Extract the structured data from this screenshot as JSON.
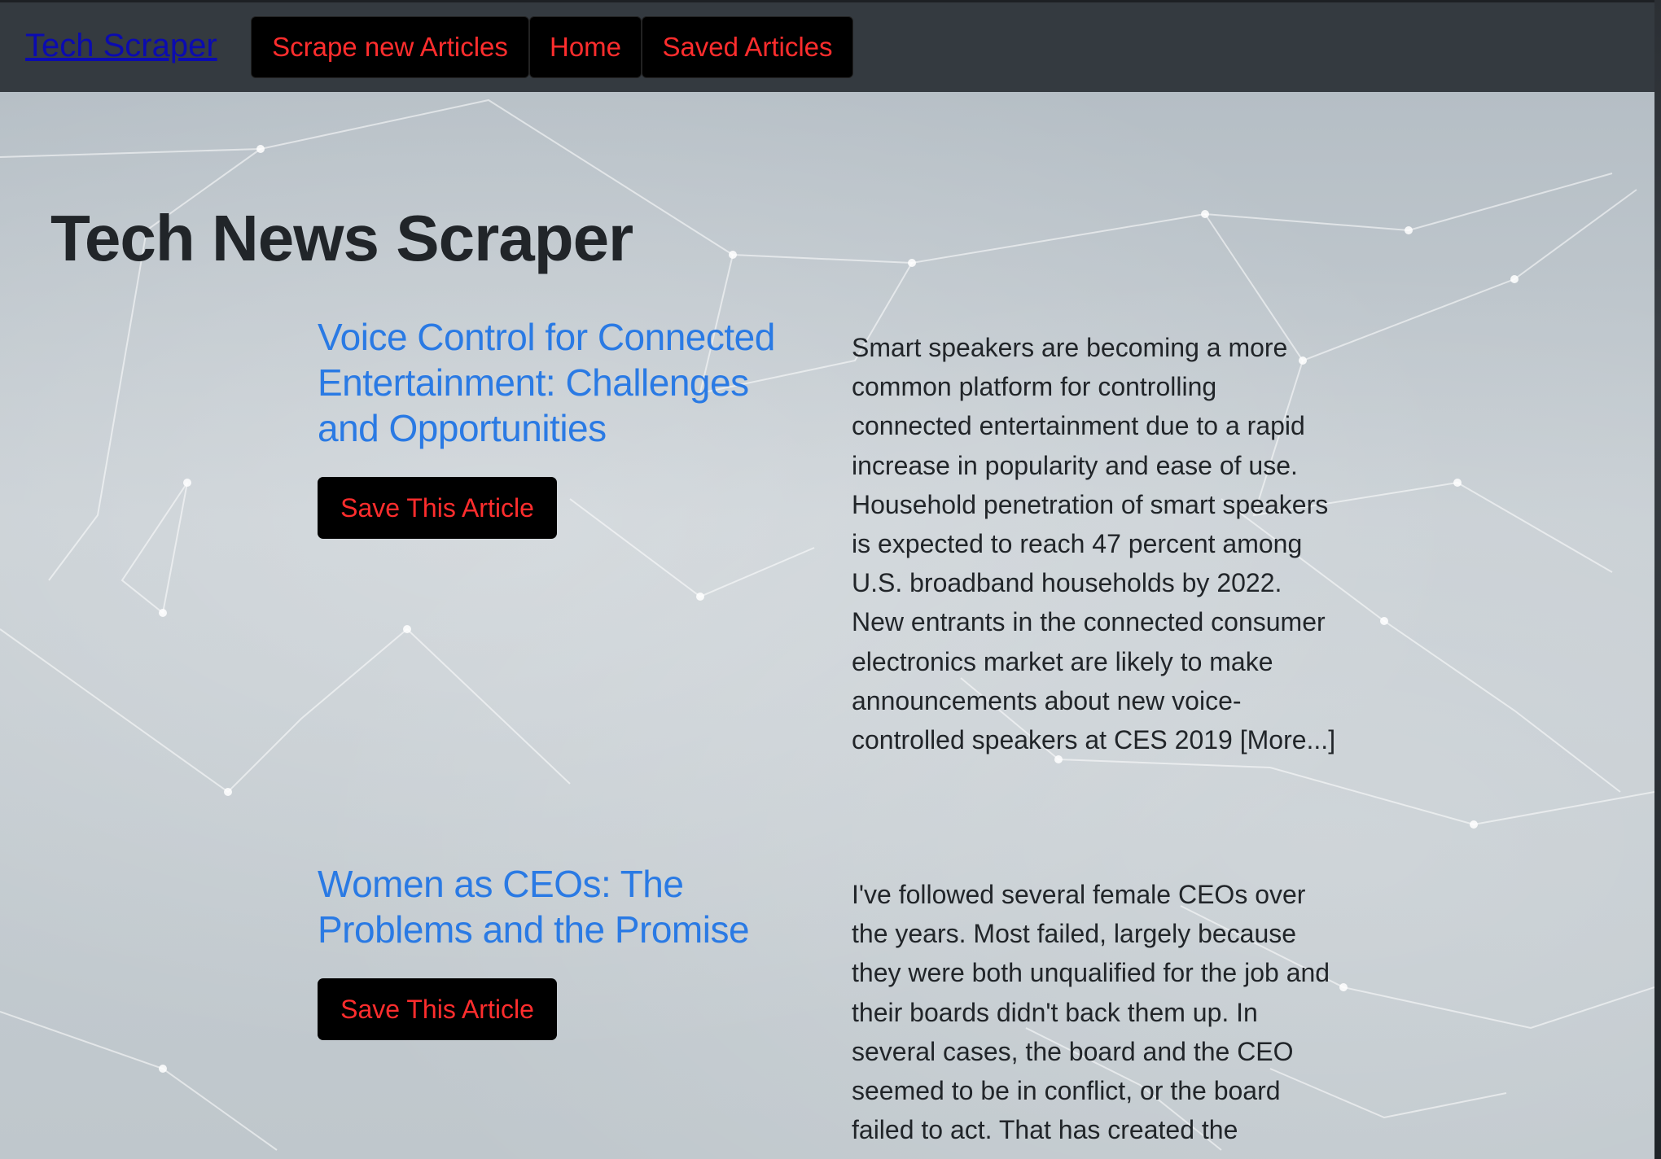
{
  "nav": {
    "brand": "Tech Scraper",
    "buttons": [
      "Scrape new Articles",
      "Home",
      "Saved Articles"
    ]
  },
  "page": {
    "title": "Tech News Scraper"
  },
  "articles": [
    {
      "title": "Voice Control for Connected Entertainment: Challenges and Opportunities",
      "save_label": "Save This Article",
      "summary": "Smart speakers are becoming a more common platform for controlling connected entertainment due to a rapid increase in popularity and ease of use. Household penetration of smart speakers is expected to reach 47 percent among U.S. broadband households by 2022. New entrants in the connected consumer electronics market are likely to make announcements about new voice-controlled speakers at CES 2019 [More...]"
    },
    {
      "title": "Women as CEOs: The Problems and the Promise",
      "save_label": "Save This Article",
      "summary": "I've followed several female CEOs over the years. Most failed, largely because they were both unqualified for the job and their boards didn't back them up. In several cases, the board and the CEO seemed to be in conflict, or the board failed to act. That has created the"
    }
  ],
  "colors": {
    "navbar": "#343a40",
    "button_bg": "#000000",
    "button_text": "#ff2d2d",
    "link": "#2a7ae4",
    "brand": "#0b0bb0"
  }
}
